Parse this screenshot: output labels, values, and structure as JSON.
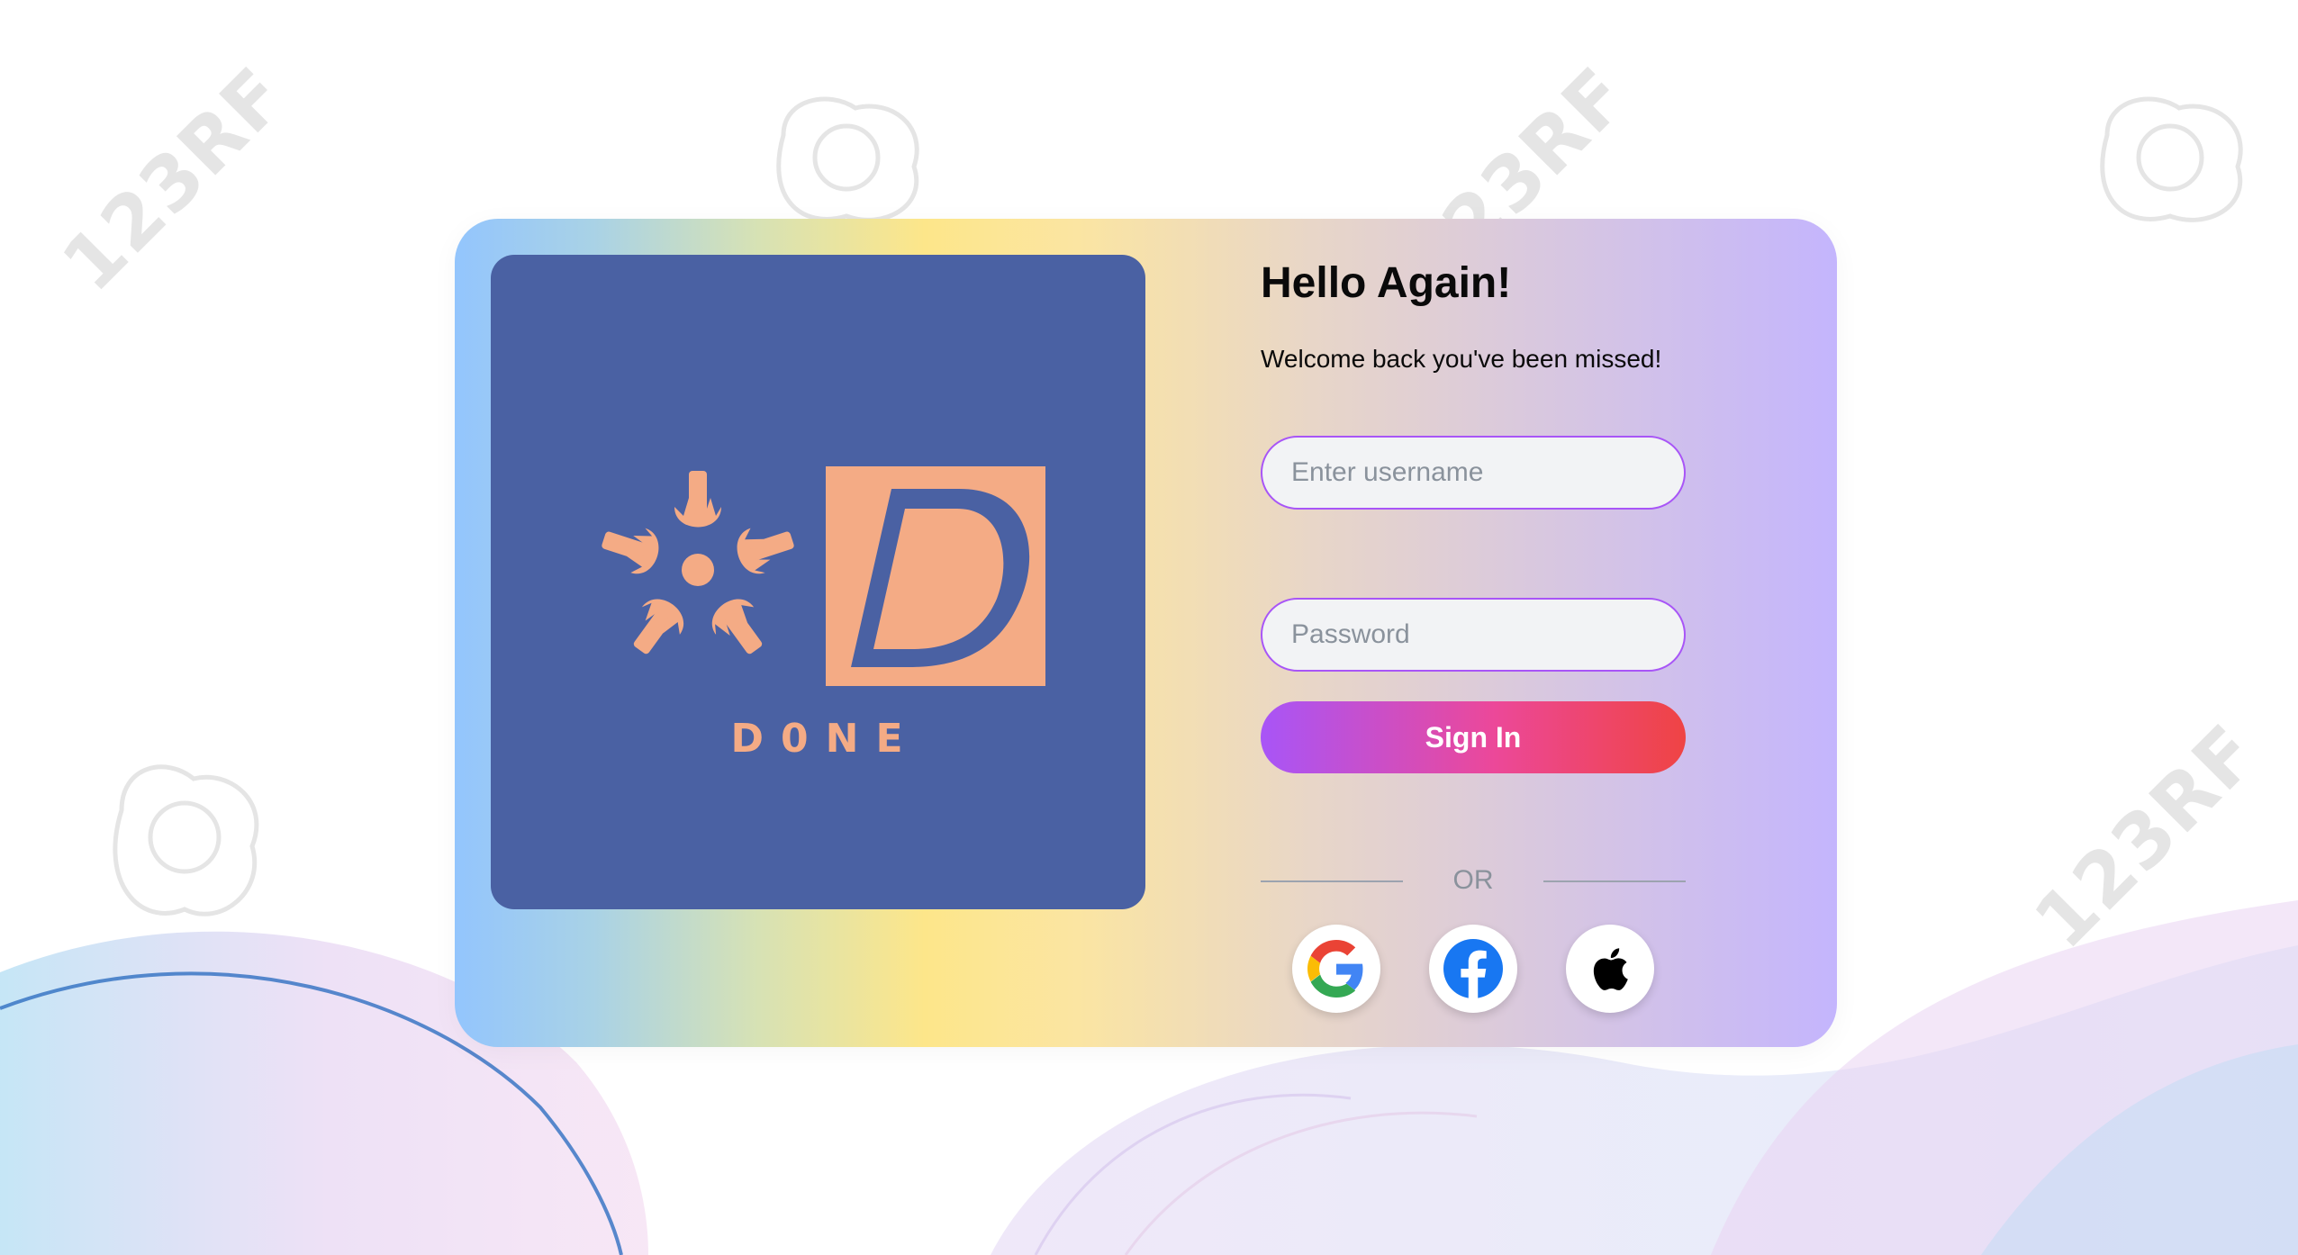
{
  "background": {
    "watermark_text": "123RF"
  },
  "logo": {
    "brand_text": "D0NE",
    "accent_color": "#f4ab85",
    "panel_color": "#4a61a3"
  },
  "login": {
    "title": "Hello Again!",
    "subtitle": "Welcome back you've been missed!",
    "username": {
      "value": "",
      "placeholder": "Enter username"
    },
    "password": {
      "value": "",
      "placeholder": "Password"
    },
    "signin_label": "Sign In",
    "divider_text": "OR",
    "social": [
      {
        "name": "google-icon"
      },
      {
        "name": "facebook-icon"
      },
      {
        "name": "apple-icon"
      }
    ]
  },
  "colors": {
    "input_border": "#a855f7",
    "button_gradient_start": "#a855f7",
    "button_gradient_mid": "#ec4899",
    "button_gradient_end": "#ef4444"
  }
}
